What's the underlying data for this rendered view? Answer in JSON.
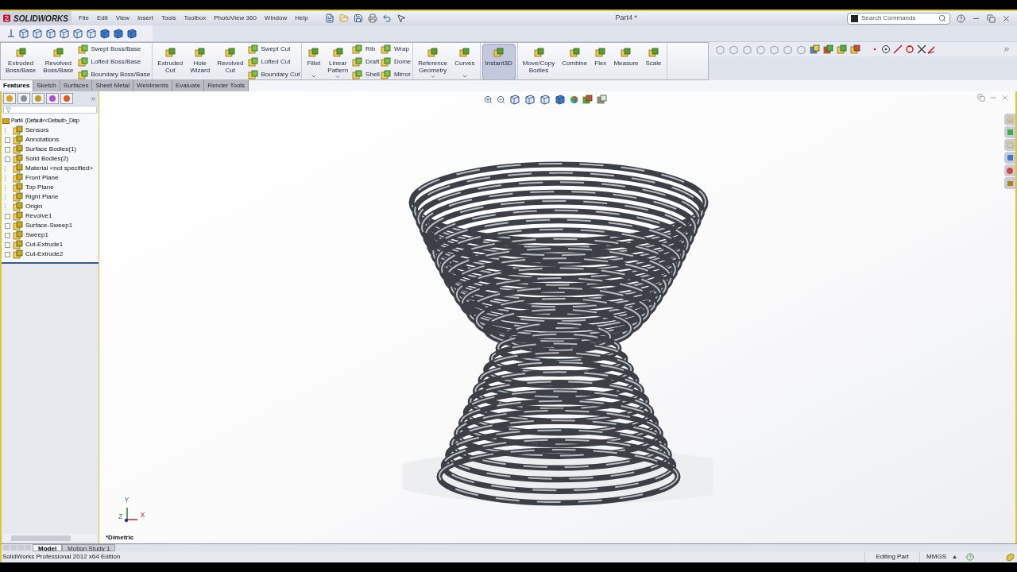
{
  "app": {
    "logo": "SOLIDWORKS",
    "title": "Part4 *",
    "search": {
      "placeholder": "Search Commands"
    }
  },
  "menu": [
    "File",
    "Edit",
    "View",
    "Insert",
    "Tools",
    "Toolbox",
    "PhotoView 360",
    "Window",
    "Help"
  ],
  "command_manager": {
    "sections": [
      {
        "items": [
          {
            "kind": "large",
            "label": "Extruded\nBoss/Base",
            "selected": false,
            "dropdown": false
          },
          {
            "kind": "large",
            "label": "Revolved\nBoss/Base",
            "selected": false,
            "dropdown": false
          },
          {
            "kind": "stack",
            "items": [
              "Swept Boss/Base",
              "Lofted Boss/Base",
              "Boundary Boss/Base"
            ]
          }
        ]
      },
      {
        "items": [
          {
            "kind": "large",
            "label": "Extruded\nCut",
            "selected": false,
            "dropdown": false
          },
          {
            "kind": "large",
            "label": "Hole\nWizard",
            "selected": false,
            "dropdown": false
          },
          {
            "kind": "large",
            "label": "Revolved\nCut",
            "selected": false,
            "dropdown": false
          },
          {
            "kind": "stack",
            "items": [
              "Swept Cut",
              "Lofted Cut",
              "Boundary Cut"
            ]
          }
        ]
      },
      {
        "items": [
          {
            "kind": "large",
            "label": "Fillet",
            "selected": false,
            "dropdown": true
          },
          {
            "kind": "large",
            "label": "Linear\nPattern",
            "selected": false,
            "dropdown": true
          },
          {
            "kind": "stack",
            "items": [
              "Rib",
              "Draft",
              "Shell"
            ]
          },
          {
            "kind": "stack",
            "items": [
              "Wrap",
              "Dome",
              "Mirror"
            ]
          }
        ]
      },
      {
        "items": [
          {
            "kind": "large",
            "label": "Reference\nGeometry",
            "selected": false,
            "dropdown": true
          },
          {
            "kind": "large",
            "label": "Curves",
            "selected": false,
            "dropdown": true
          }
        ]
      },
      {
        "items": [
          {
            "kind": "large",
            "label": "Instant3D",
            "selected": true,
            "dropdown": false
          }
        ]
      },
      {
        "items": [
          {
            "kind": "large",
            "label": "Move/Copy\nBodies",
            "selected": false,
            "dropdown": false
          },
          {
            "kind": "large",
            "label": "Combine",
            "selected": false,
            "dropdown": false
          },
          {
            "kind": "large",
            "label": "Flex",
            "selected": false,
            "dropdown": false
          },
          {
            "kind": "large",
            "label": "Measure",
            "selected": false,
            "dropdown": false
          },
          {
            "kind": "large",
            "label": "Scale",
            "selected": false,
            "dropdown": false
          }
        ]
      }
    ]
  },
  "tabs": [
    {
      "label": "Features",
      "selected": true
    },
    {
      "label": "Sketch",
      "selected": false
    },
    {
      "label": "Surfaces",
      "selected": false
    },
    {
      "label": "Sheet Metal",
      "selected": false
    },
    {
      "label": "Weldments",
      "selected": false
    },
    {
      "label": "Evaluate",
      "selected": false
    },
    {
      "label": "Render Tools",
      "selected": false
    }
  ],
  "tree": {
    "root": "Part4  (Default<<Default>_Disp",
    "items": [
      {
        "label": "Sensors",
        "expandable": false
      },
      {
        "label": "Annotations",
        "expandable": true
      },
      {
        "label": "Surface Bodies(1)",
        "expandable": true
      },
      {
        "label": "Solid Bodies(2)",
        "expandable": true
      },
      {
        "label": "Material <not specified>",
        "expandable": false
      },
      {
        "label": "Front Plane",
        "expandable": false
      },
      {
        "label": "Top Plane",
        "expandable": false
      },
      {
        "label": "Right Plane",
        "expandable": false
      },
      {
        "label": "Origin",
        "expandable": false
      },
      {
        "label": "Revolve1",
        "expandable": true
      },
      {
        "label": "Surface-Sweep1",
        "expandable": true
      },
      {
        "label": "Sweep1",
        "expandable": true
      },
      {
        "label": "Cut-Extrude1",
        "expandable": true
      },
      {
        "label": "Cut-Extrude2",
        "expandable": true
      }
    ]
  },
  "viewport": {
    "orientation": "*Dimetric",
    "triad": {
      "x": "X",
      "y": "Y",
      "z": "Z"
    }
  },
  "bottom_tabs": [
    {
      "label": "Model",
      "selected": true
    },
    {
      "label": "Motion Study 1",
      "selected": false
    }
  ],
  "status_bar": {
    "edition": "SolidWorks Professional 2012 x64 Edition",
    "mode": "Editing Part",
    "units": "MMGS"
  }
}
